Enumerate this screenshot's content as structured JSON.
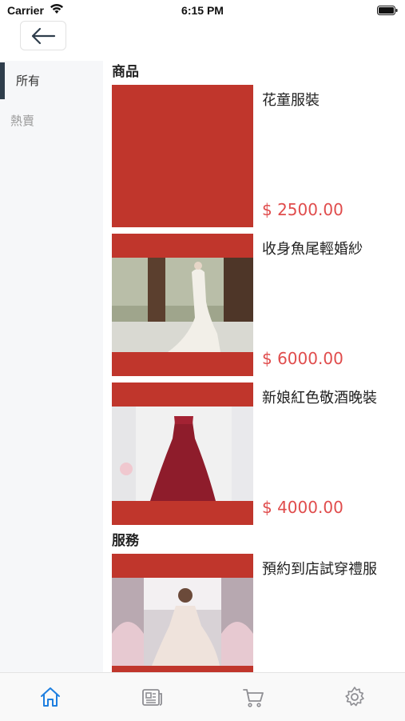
{
  "status": {
    "carrier": "Carrier",
    "time": "6:15 PM"
  },
  "sidebar": {
    "items": [
      {
        "label": "所有",
        "active": true
      },
      {
        "label": "熱賣",
        "active": false
      }
    ]
  },
  "sections": [
    {
      "title": "商品",
      "items": [
        {
          "name": "花童服裝",
          "price": "$ 2500.00",
          "image": "solid-red-placeholder"
        },
        {
          "name": "收身魚尾輕婚紗",
          "price": "$ 6000.00",
          "image": "white-mermaid-gown-photo"
        },
        {
          "name": "新娘紅色敬酒晚裝",
          "price": "$ 4000.00",
          "image": "red-evening-gown-photo"
        }
      ]
    },
    {
      "title": "服務",
      "items": [
        {
          "name": "預約到店試穿禮服",
          "image": "bride-fitting-room-photo"
        }
      ]
    }
  ],
  "tabs": [
    {
      "icon": "home-icon",
      "active": true
    },
    {
      "icon": "news-icon",
      "active": false
    },
    {
      "icon": "cart-icon",
      "active": false
    },
    {
      "icon": "settings-icon",
      "active": false
    }
  ],
  "colors": {
    "accent": "#1e7fe0",
    "price": "#e04c4c",
    "thumb_bg": "#c0362c",
    "sidebar_bg": "#f6f7f9"
  }
}
